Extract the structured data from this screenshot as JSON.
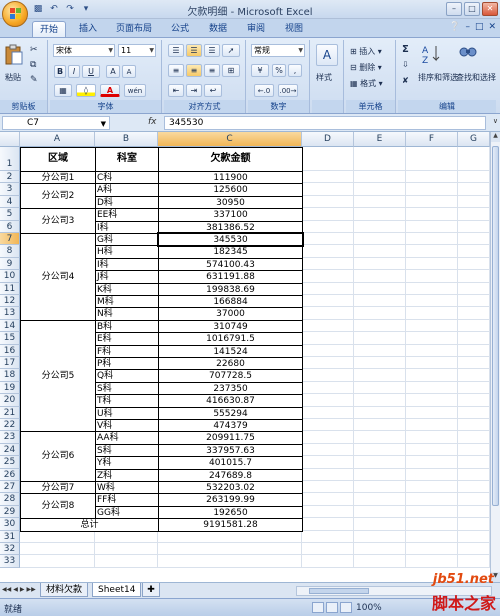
{
  "window": {
    "title": "欠款明细 - Microsoft Excel"
  },
  "tabs": [
    "开始",
    "插入",
    "页面布局",
    "公式",
    "数据",
    "审阅",
    "视图"
  ],
  "ribbon": {
    "clipboard": {
      "paste": "粘贴",
      "label": "剪贴板"
    },
    "font": {
      "name": "宋体",
      "size": "11",
      "label": "字体",
      "bold": "B",
      "italic": "I",
      "underline": "U",
      "grow": "A",
      "shrink": "A",
      "color_a": "A",
      "wen": "wén"
    },
    "alignment": {
      "label": "对齐方式"
    },
    "number": {
      "format": "常规",
      "label": "数字",
      "percent": "%",
      "comma": ","
    },
    "styles": {
      "label": "样式"
    },
    "cells": {
      "insert": "插入",
      "delete": "删除",
      "format": "格式",
      "label": "单元格"
    },
    "editing": {
      "sort": "排序和筛选",
      "find": "查找和选择",
      "label": "编辑",
      "sigma": "Σ"
    }
  },
  "formula_bar": {
    "name_box": "C7",
    "fx": "fx",
    "value": "345530"
  },
  "columns": [
    "A",
    "B",
    "C",
    "D",
    "E",
    "F",
    "G"
  ],
  "table": {
    "headers": [
      "区域",
      "科室",
      "欠款金额"
    ],
    "rows": [
      [
        "C科",
        "111900"
      ],
      [
        "A科",
        "125600"
      ],
      [
        "D科",
        "30950"
      ],
      [
        "EE科",
        "337100"
      ],
      [
        "I科",
        "381386.52"
      ],
      [
        "G科",
        "345530"
      ],
      [
        "H科",
        "182345"
      ],
      [
        "I科",
        "574100.43"
      ],
      [
        "J科",
        "631191.88"
      ],
      [
        "K科",
        "199838.69"
      ],
      [
        "M科",
        "166884"
      ],
      [
        "N科",
        "37000"
      ],
      [
        "B科",
        "310749"
      ],
      [
        "E科",
        "1016791.5"
      ],
      [
        "F科",
        "141524"
      ],
      [
        "P科",
        "22680"
      ],
      [
        "Q科",
        "707728.5"
      ],
      [
        "S科",
        "237350"
      ],
      [
        "T科",
        "416630.87"
      ],
      [
        "U科",
        "555294"
      ],
      [
        "V科",
        "474379"
      ],
      [
        "AA科",
        "209911.75"
      ],
      [
        "S科",
        "337957.63"
      ],
      [
        "Y科",
        "401015.7"
      ],
      [
        "Z科",
        "247689.8"
      ],
      [
        "W科",
        "532203.02"
      ],
      [
        "FF科",
        "263199.99"
      ],
      [
        "GG科",
        "192650"
      ]
    ],
    "regions": [
      {
        "name": "分公司1",
        "start": 2,
        "end": 2
      },
      {
        "name": "分公司2",
        "start": 3,
        "end": 4
      },
      {
        "name": "分公司3",
        "start": 5,
        "end": 6
      },
      {
        "name": "分公司4",
        "start": 7,
        "end": 13
      },
      {
        "name": "分公司5",
        "start": 14,
        "end": 22
      },
      {
        "name": "分公司6",
        "start": 23,
        "end": 26
      },
      {
        "name": "分公司7",
        "start": 27,
        "end": 27
      },
      {
        "name": "分公司8",
        "start": 28,
        "end": 29
      }
    ],
    "total_label": "总计",
    "total_value": "9191581.28"
  },
  "row_numbers": [
    "1",
    "2",
    "3",
    "4",
    "5",
    "6",
    "7",
    "8",
    "9",
    "10",
    "11",
    "12",
    "13",
    "14",
    "15",
    "16",
    "17",
    "18",
    "19",
    "20",
    "21",
    "22",
    "23",
    "24",
    "25",
    "26",
    "27",
    "28",
    "29",
    "30",
    "31",
    "32",
    "33"
  ],
  "sheet_tabs": [
    "材料欠款",
    "Sheet14"
  ],
  "status": {
    "ready": "就绪",
    "zoom": "100%"
  },
  "watermark": {
    "site": "jb51.net",
    "name": "脚本之家"
  },
  "icons": [
    "office-logo-icon",
    "save-icon",
    "undo-icon",
    "redo-icon",
    "minimize-icon",
    "maximize-icon",
    "close-icon",
    "help-icon",
    "paste-icon",
    "cut-icon",
    "copy-icon",
    "format-painter-icon",
    "sigma-icon",
    "sort-icon",
    "find-icon"
  ]
}
